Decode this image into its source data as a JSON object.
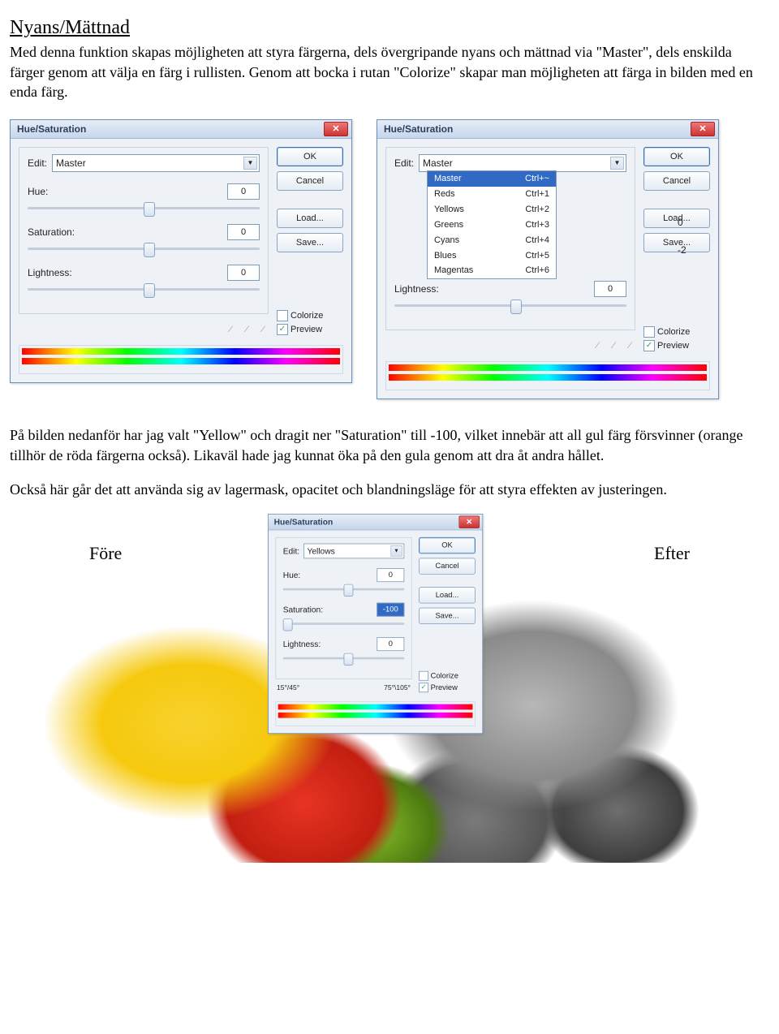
{
  "heading": "Nyans/Mättnad",
  "para1": "Med denna funktion skapas möjligheten att styra färgerna, dels övergripande nyans och mättnad via \"Master\", dels enskilda färger genom att välja en färg i rullisten. Genom att bocka i rutan \"Colorize\" skapar man möjligheten att färga in bilden med en enda färg.",
  "para2": "På bilden nedanför har jag valt \"Yellow\" och dragit ner \"Saturation\" till -100, vilket innebär att all gul färg försvinner (orange tillhör de röda färgerna också). Likaväl hade jag kunnat öka på den gula genom att dra åt andra hållet.",
  "para3": "Också här går det att använda sig av lagermask, opacitet och blandningsläge för att styra effekten av justeringen.",
  "dlg": {
    "title": "Hue/Saturation",
    "editLabel": "Edit:",
    "hueLabel": "Hue:",
    "satLabel": "Saturation:",
    "lightLabel": "Lightness:",
    "ok": "OK",
    "cancel": "Cancel",
    "load": "Load...",
    "save": "Save...",
    "colorize": "Colorize",
    "preview": "Preview"
  },
  "left": {
    "editValue": "Master",
    "hue": "0",
    "sat": "0",
    "light": "0"
  },
  "right": {
    "editValue": "Master",
    "hue": "0",
    "sat": "-2",
    "light": "0",
    "options": [
      {
        "name": "Master",
        "short": "Ctrl+~"
      },
      {
        "name": "Reds",
        "short": "Ctrl+1"
      },
      {
        "name": "Yellows",
        "short": "Ctrl+2"
      },
      {
        "name": "Greens",
        "short": "Ctrl+3"
      },
      {
        "name": "Cyans",
        "short": "Ctrl+4"
      },
      {
        "name": "Blues",
        "short": "Ctrl+5"
      },
      {
        "name": "Magentas",
        "short": "Ctrl+6"
      }
    ]
  },
  "small": {
    "editValue": "Yellows",
    "hue": "0",
    "sat": "-100",
    "light": "0",
    "rangeLeft": "15°/45°",
    "rangeRight": "75°\\105°"
  },
  "fruit": {
    "before": "Före",
    "after": "Efter"
  }
}
